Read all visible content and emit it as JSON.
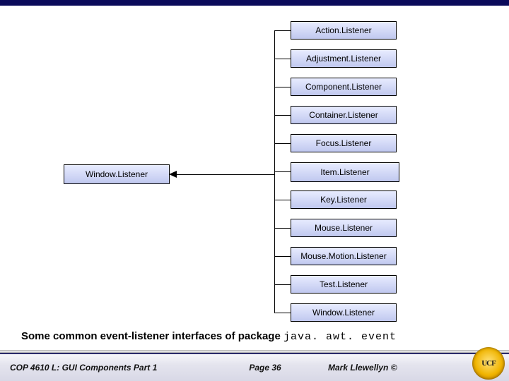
{
  "diagram": {
    "left_box": "Window.Listener",
    "right_boxes": [
      "Action.Listener",
      "Adjustment.Listener",
      "Component.Listener",
      "Container.Listener",
      "Focus.Listener",
      "Item.Listener",
      "Key.Listener",
      "Mouse.Listener",
      "Mouse.Motion.Listener",
      "Test.Listener",
      "Window.Listener"
    ]
  },
  "caption": {
    "text": "Some common event-listener interfaces of package ",
    "package": "java. awt. event"
  },
  "footer": {
    "course": "COP 4610 L: GUI Components Part 1",
    "page": "Page 36",
    "author": "Mark Llewellyn ©",
    "logo_text": "UCF"
  }
}
